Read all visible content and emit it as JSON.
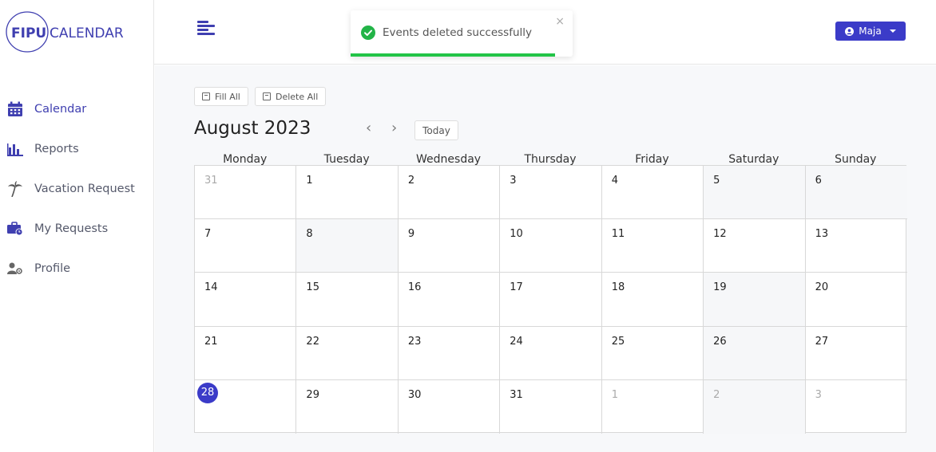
{
  "app": {
    "logo_word1": "FIPU",
    "logo_word2": "CALENDAR"
  },
  "sidebar": {
    "items": [
      {
        "label": "Calendar",
        "icon": "calendar-icon"
      },
      {
        "label": "Reports",
        "icon": "bar-chart-icon"
      },
      {
        "label": "Vacation Request",
        "icon": "palm-tree-icon"
      },
      {
        "label": "My Requests",
        "icon": "briefcase-icon"
      },
      {
        "label": "Profile",
        "icon": "user-gear-icon"
      }
    ]
  },
  "header": {
    "user_name": "Maja"
  },
  "toast": {
    "message": "Events deleted successfully",
    "close": "×",
    "progress": 0.92
  },
  "toolbar": {
    "fill_all": "Fill All",
    "delete_all": "Delete All"
  },
  "calendar": {
    "month_title": "August 2023",
    "prev": "‹",
    "next": "›",
    "today_label": "Today",
    "weekdays": [
      "Monday",
      "Tuesday",
      "Wednesday",
      "Thursday",
      "Friday",
      "Saturday",
      "Sunday"
    ],
    "weeks": [
      [
        "31",
        "1",
        "2",
        "3",
        "4",
        "5",
        "6"
      ],
      [
        "7",
        "8",
        "9",
        "10",
        "11",
        "12",
        "13"
      ],
      [
        "14",
        "15",
        "16",
        "17",
        "18",
        "19",
        "20"
      ],
      [
        "21",
        "22",
        "23",
        "24",
        "25",
        "26",
        "27"
      ],
      [
        "28",
        "29",
        "30",
        "31",
        "1",
        "2",
        "3"
      ]
    ]
  },
  "colors": {
    "accent": "#3b3bc8",
    "success": "#22c447"
  }
}
